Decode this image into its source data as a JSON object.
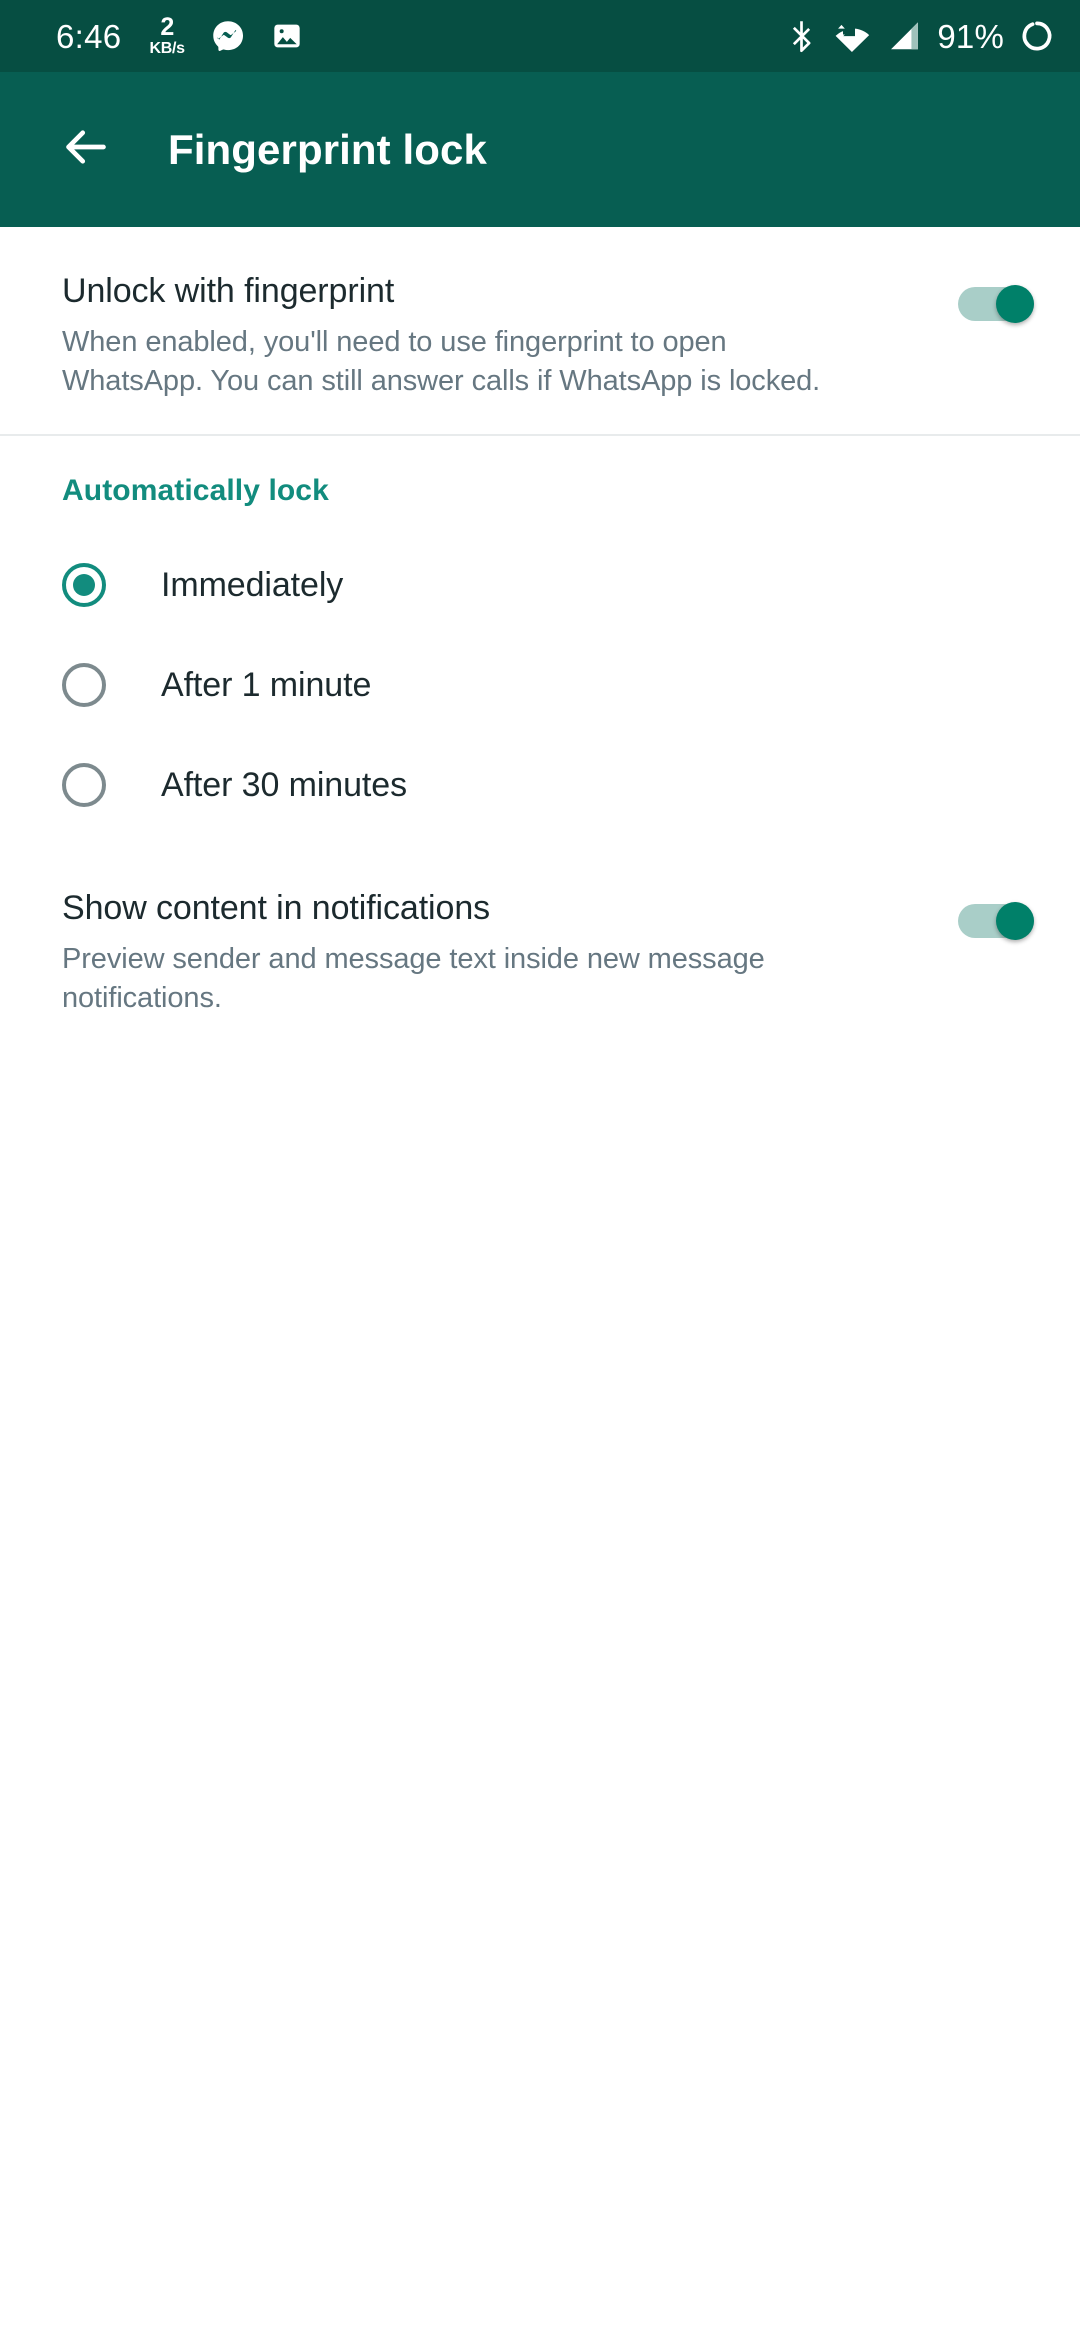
{
  "status_bar": {
    "clock": "6:46",
    "net_speed_value": "2",
    "net_speed_unit": "KB/s",
    "messenger_icon": "messenger-icon",
    "gallery_icon": "image-icon",
    "bluetooth_icon": "bluetooth-icon",
    "wifi_icon": "wifi-icon",
    "signal_icon": "cellular-signal-icon",
    "battery_percent": "91%",
    "battery_icon": "battery-circle-icon",
    "background_color": "#064e42",
    "foreground_color": "#ffffff"
  },
  "app_bar": {
    "back_icon": "back-arrow-icon",
    "title": "Fingerprint lock",
    "background_color": "#075e52",
    "title_color": "#ffffff"
  },
  "unlock_setting": {
    "title": "Unlock with fingerprint",
    "description": "When enabled, you'll need to use fingerprint to open WhatsApp. You can still answer calls if WhatsApp is locked.",
    "toggle_state": "on",
    "toggle_on_color": "#008069",
    "toggle_track_color": "#a9cec8"
  },
  "auto_lock": {
    "header": "Automatically lock",
    "header_color": "#128c7e",
    "selected_value": "Immediately",
    "options": [
      {
        "label": "Immediately",
        "selected": true
      },
      {
        "label": "After 1 minute",
        "selected": false
      },
      {
        "label": "After 30 minutes",
        "selected": false
      }
    ]
  },
  "notifications_setting": {
    "title": "Show content in notifications",
    "description": "Preview sender and message text inside new message notifications.",
    "toggle_state": "on"
  },
  "colors": {
    "page_background": "#ffffff",
    "primary_text": "#1c2a2e",
    "secondary_text": "#667781",
    "accent": "#128c7e",
    "divider": "#e8ebec"
  }
}
